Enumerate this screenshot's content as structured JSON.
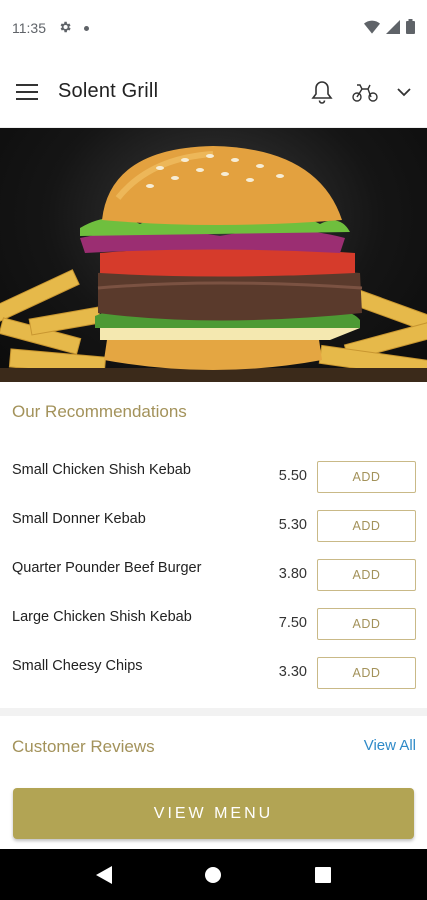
{
  "status_bar": {
    "time": "11:35",
    "icons": [
      "gear-icon",
      "notification-dot-icon",
      "wifi-icon",
      "signal-icon",
      "battery-icon"
    ]
  },
  "app_bar": {
    "title": "Solent Grill",
    "icons": [
      "menu-icon",
      "bell-icon",
      "delivery-scooter-icon",
      "chevron-down-icon"
    ]
  },
  "hero": {
    "subject": "burger-image"
  },
  "recommendations": {
    "title": "Our Recommendations",
    "items": [
      {
        "name": "Small Chicken Shish Kebab",
        "price": "5.50",
        "action": "ADD"
      },
      {
        "name": "Small Donner Kebab",
        "price": "5.30",
        "action": "ADD"
      },
      {
        "name": "Quarter Pounder Beef Burger",
        "price": "3.80",
        "action": "ADD"
      },
      {
        "name": "Large Chicken Shish Kebab",
        "price": "7.50",
        "action": "ADD"
      },
      {
        "name": "Small Cheesy Chips",
        "price": "3.30",
        "action": "ADD"
      }
    ]
  },
  "reviews": {
    "title": "Customer Reviews",
    "view_all": "View All"
  },
  "cta": {
    "label": "VIEW MENU"
  },
  "colors": {
    "accent_gold": "#b2a454",
    "heading_gold": "#a3925a",
    "link_blue": "#2f8ac8"
  }
}
